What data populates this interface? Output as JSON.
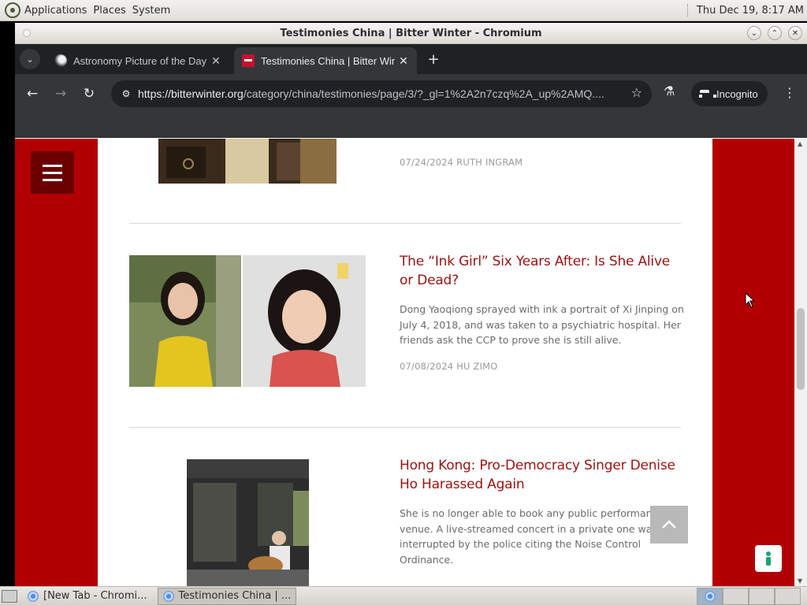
{
  "panel": {
    "menus": [
      "Applications",
      "Places",
      "System"
    ],
    "clock": "Thu Dec 19,  8:17 AM"
  },
  "window": {
    "title": "Testimonies China | Bitter Winter - Chromium"
  },
  "tabs": [
    {
      "title": "Astronomy Picture of the Day",
      "active": false
    },
    {
      "title": "Testimonies China | Bitter Winter",
      "active": true
    }
  ],
  "toolbar": {
    "url_host": "https://bitterwinter.org",
    "url_path": "/category/china/testimonies/page/3/?_gl=1%2A2n7czq%2A_up%2AMQ....",
    "incognito_label": "Incognito"
  },
  "articles": [
    {
      "title": "",
      "excerpt": "",
      "meta": "07/24/2024 RUTH INGRAM"
    },
    {
      "title": "The “Ink Girl” Six Years After: Is She Alive or Dead?",
      "excerpt": "Dong Yaoqiong sprayed with ink a portrait of Xi Jinping on July 4, 2018, and was taken to a psychiatric hospital. Her friends ask the CCP to prove she is still alive.",
      "meta": "07/08/2024 HU ZIMO"
    },
    {
      "title": "Hong Kong: Pro-Democracy Singer Denise Ho Harassed Again",
      "excerpt": "She is no longer able to book any public performance venue. A live-streamed concert in a private one was interrupted by the police citing the Noise Control Ordinance.",
      "meta": ""
    }
  ],
  "taskbar": {
    "tasks": [
      {
        "label": "[New Tab - Chromi...",
        "active": false
      },
      {
        "label": "Testimonies China | ...",
        "active": true
      }
    ]
  }
}
